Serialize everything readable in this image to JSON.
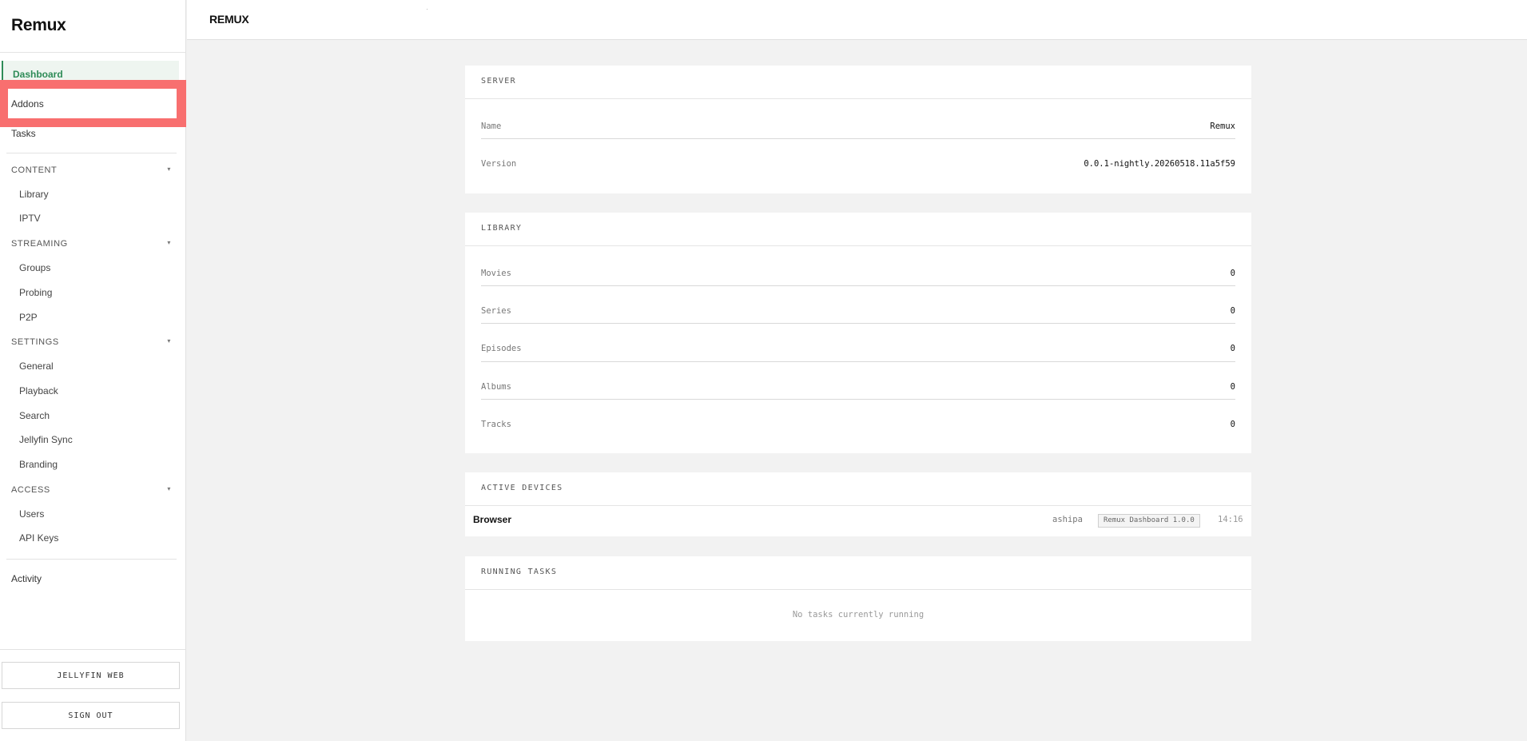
{
  "app": {
    "brand": "Remux",
    "header_title": "REMUX"
  },
  "sidebar": {
    "top_items": [
      {
        "label": "Dashboard",
        "active": true
      },
      {
        "label": "Addons",
        "highlighted": true
      },
      {
        "label": "Tasks"
      }
    ],
    "sections": [
      {
        "title": "CONTENT",
        "items": [
          "Library",
          "IPTV"
        ]
      },
      {
        "title": "STREAMING",
        "items": [
          "Groups",
          "Probing",
          "P2P"
        ]
      },
      {
        "title": "SETTINGS",
        "items": [
          "General",
          "Playback",
          "Search",
          "Jellyfin Sync",
          "Branding"
        ]
      },
      {
        "title": "ACCESS",
        "items": [
          "Users",
          "API Keys"
        ]
      }
    ],
    "activity_label": "Activity",
    "jellyfin_web_label": "JELLYFIN WEB",
    "sign_out_label": "SIGN OUT",
    "caret_icon": "▾"
  },
  "server": {
    "title": "SERVER",
    "rows": [
      {
        "label": "Name",
        "value": "Remux"
      },
      {
        "label": "Version",
        "value": "0.0.1-nightly.20260518.11a5f59"
      }
    ]
  },
  "library": {
    "title": "LIBRARY",
    "rows": [
      {
        "label": "Movies",
        "value": "0"
      },
      {
        "label": "Series",
        "value": "0"
      },
      {
        "label": "Episodes",
        "value": "0"
      },
      {
        "label": "Albums",
        "value": "0"
      },
      {
        "label": "Tracks",
        "value": "0"
      }
    ]
  },
  "active_devices": {
    "title": "ACTIVE DEVICES",
    "devices": [
      {
        "name": "Browser",
        "user": "ashipa",
        "client": "Remux Dashboard 1.0.0",
        "time": "14:16"
      }
    ]
  },
  "running_tasks": {
    "title": "RUNNING TASKS",
    "empty_message": "No tasks currently running"
  },
  "colors": {
    "accent": "#2e8b57",
    "highlight": "#f86f6f",
    "background": "#f2f2f2"
  }
}
